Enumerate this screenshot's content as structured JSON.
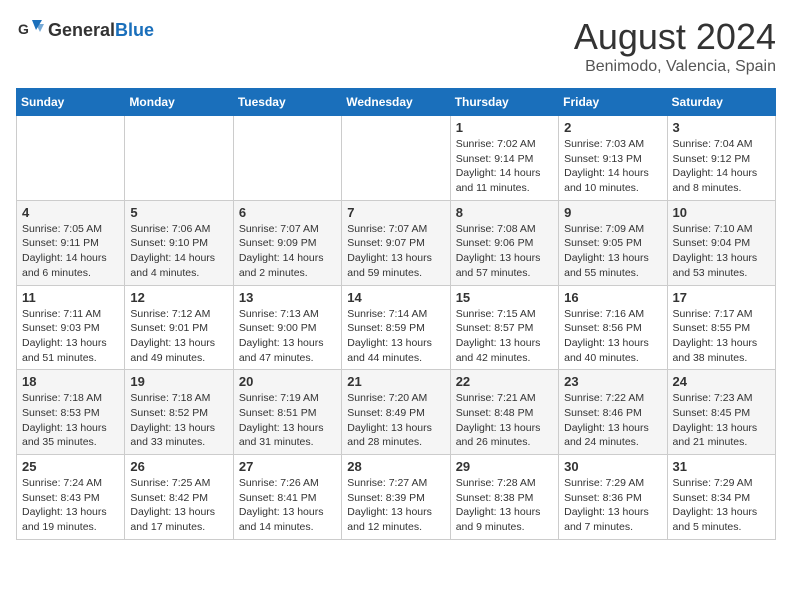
{
  "header": {
    "logo_general": "General",
    "logo_blue": "Blue",
    "title": "August 2024",
    "subtitle": "Benimodo, Valencia, Spain"
  },
  "columns": [
    "Sunday",
    "Monday",
    "Tuesday",
    "Wednesday",
    "Thursday",
    "Friday",
    "Saturday"
  ],
  "weeks": [
    [
      {
        "day": "",
        "info": ""
      },
      {
        "day": "",
        "info": ""
      },
      {
        "day": "",
        "info": ""
      },
      {
        "day": "",
        "info": ""
      },
      {
        "day": "1",
        "info": "Sunrise: 7:02 AM\nSunset: 9:14 PM\nDaylight: 14 hours and 11 minutes."
      },
      {
        "day": "2",
        "info": "Sunrise: 7:03 AM\nSunset: 9:13 PM\nDaylight: 14 hours and 10 minutes."
      },
      {
        "day": "3",
        "info": "Sunrise: 7:04 AM\nSunset: 9:12 PM\nDaylight: 14 hours and 8 minutes."
      }
    ],
    [
      {
        "day": "4",
        "info": "Sunrise: 7:05 AM\nSunset: 9:11 PM\nDaylight: 14 hours and 6 minutes."
      },
      {
        "day": "5",
        "info": "Sunrise: 7:06 AM\nSunset: 9:10 PM\nDaylight: 14 hours and 4 minutes."
      },
      {
        "day": "6",
        "info": "Sunrise: 7:07 AM\nSunset: 9:09 PM\nDaylight: 14 hours and 2 minutes."
      },
      {
        "day": "7",
        "info": "Sunrise: 7:07 AM\nSunset: 9:07 PM\nDaylight: 13 hours and 59 minutes."
      },
      {
        "day": "8",
        "info": "Sunrise: 7:08 AM\nSunset: 9:06 PM\nDaylight: 13 hours and 57 minutes."
      },
      {
        "day": "9",
        "info": "Sunrise: 7:09 AM\nSunset: 9:05 PM\nDaylight: 13 hours and 55 minutes."
      },
      {
        "day": "10",
        "info": "Sunrise: 7:10 AM\nSunset: 9:04 PM\nDaylight: 13 hours and 53 minutes."
      }
    ],
    [
      {
        "day": "11",
        "info": "Sunrise: 7:11 AM\nSunset: 9:03 PM\nDaylight: 13 hours and 51 minutes."
      },
      {
        "day": "12",
        "info": "Sunrise: 7:12 AM\nSunset: 9:01 PM\nDaylight: 13 hours and 49 minutes."
      },
      {
        "day": "13",
        "info": "Sunrise: 7:13 AM\nSunset: 9:00 PM\nDaylight: 13 hours and 47 minutes."
      },
      {
        "day": "14",
        "info": "Sunrise: 7:14 AM\nSunset: 8:59 PM\nDaylight: 13 hours and 44 minutes."
      },
      {
        "day": "15",
        "info": "Sunrise: 7:15 AM\nSunset: 8:57 PM\nDaylight: 13 hours and 42 minutes."
      },
      {
        "day": "16",
        "info": "Sunrise: 7:16 AM\nSunset: 8:56 PM\nDaylight: 13 hours and 40 minutes."
      },
      {
        "day": "17",
        "info": "Sunrise: 7:17 AM\nSunset: 8:55 PM\nDaylight: 13 hours and 38 minutes."
      }
    ],
    [
      {
        "day": "18",
        "info": "Sunrise: 7:18 AM\nSunset: 8:53 PM\nDaylight: 13 hours and 35 minutes."
      },
      {
        "day": "19",
        "info": "Sunrise: 7:18 AM\nSunset: 8:52 PM\nDaylight: 13 hours and 33 minutes."
      },
      {
        "day": "20",
        "info": "Sunrise: 7:19 AM\nSunset: 8:51 PM\nDaylight: 13 hours and 31 minutes."
      },
      {
        "day": "21",
        "info": "Sunrise: 7:20 AM\nSunset: 8:49 PM\nDaylight: 13 hours and 28 minutes."
      },
      {
        "day": "22",
        "info": "Sunrise: 7:21 AM\nSunset: 8:48 PM\nDaylight: 13 hours and 26 minutes."
      },
      {
        "day": "23",
        "info": "Sunrise: 7:22 AM\nSunset: 8:46 PM\nDaylight: 13 hours and 24 minutes."
      },
      {
        "day": "24",
        "info": "Sunrise: 7:23 AM\nSunset: 8:45 PM\nDaylight: 13 hours and 21 minutes."
      }
    ],
    [
      {
        "day": "25",
        "info": "Sunrise: 7:24 AM\nSunset: 8:43 PM\nDaylight: 13 hours and 19 minutes."
      },
      {
        "day": "26",
        "info": "Sunrise: 7:25 AM\nSunset: 8:42 PM\nDaylight: 13 hours and 17 minutes."
      },
      {
        "day": "27",
        "info": "Sunrise: 7:26 AM\nSunset: 8:41 PM\nDaylight: 13 hours and 14 minutes."
      },
      {
        "day": "28",
        "info": "Sunrise: 7:27 AM\nSunset: 8:39 PM\nDaylight: 13 hours and 12 minutes."
      },
      {
        "day": "29",
        "info": "Sunrise: 7:28 AM\nSunset: 8:38 PM\nDaylight: 13 hours and 9 minutes."
      },
      {
        "day": "30",
        "info": "Sunrise: 7:29 AM\nSunset: 8:36 PM\nDaylight: 13 hours and 7 minutes."
      },
      {
        "day": "31",
        "info": "Sunrise: 7:29 AM\nSunset: 8:34 PM\nDaylight: 13 hours and 5 minutes."
      }
    ]
  ]
}
